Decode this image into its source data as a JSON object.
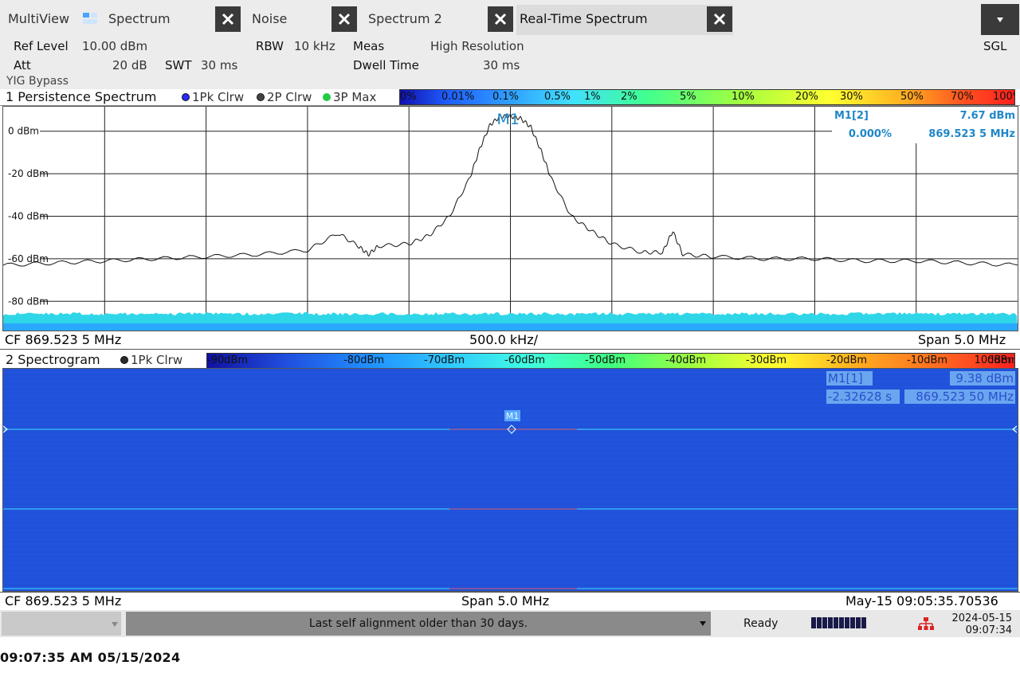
{
  "tabs": {
    "multiview": "MultiView",
    "items": [
      {
        "label": "Spectrum"
      },
      {
        "label": "Noise"
      },
      {
        "label": "Spectrum 2"
      },
      {
        "label": "Real-Time Spectrum"
      }
    ]
  },
  "settings": {
    "ref_level_label": "Ref Level",
    "ref_level_value": "10.00 dBm",
    "att_label": "Att",
    "att_value": "20 dB",
    "swt_label": "SWT",
    "swt_value": "30 ms",
    "rbw_label": "RBW",
    "rbw_value": "10 kHz",
    "meas_label": "Meas",
    "meas_value": "High Resolution",
    "dwell_label": "Dwell Time",
    "dwell_value": "30 ms",
    "yig": "YIG Bypass",
    "sgl": "SGL"
  },
  "panel1": {
    "title": "1 Persistence Spectrum",
    "traces": [
      "1Pk Clrw",
      "2P Clrw",
      "3P Max"
    ],
    "trace_colors": [
      "#2a2aff",
      "#444444",
      "#22cc44"
    ],
    "colorbar_labels": [
      "0%",
      "0.01%",
      "0.1%",
      "0.5%",
      "1%",
      "2%",
      "5%",
      "10%",
      "20%",
      "30%",
      "50%",
      "70%",
      "100%"
    ],
    "marker_label": "M1",
    "marker_info": {
      "name": "M1[2]",
      "level": "7.67 dBm",
      "percent": "0.000%",
      "freq": "869.523 5 MHz"
    },
    "cf": "CF 869.523 5 MHz",
    "div": "500.0 kHz/",
    "span": "Span 5.0 MHz"
  },
  "chart_data": {
    "type": "line",
    "title": "1 Persistence Spectrum",
    "xlabel": "",
    "ylabel": "",
    "x_center_mhz": 869.5235,
    "x_span_mhz": 5.0,
    "ylim": [
      -90,
      10
    ],
    "y_ticks": [
      "0 dBm",
      "-20 dBm",
      "-40 dBm",
      "-60 dBm",
      "-80 dBm"
    ],
    "y_tick_values": [
      0,
      -20,
      -40,
      -60,
      -80
    ],
    "grid": true,
    "series": [
      {
        "x": [
          -2.5,
          -2.25,
          -2.0,
          -1.75,
          -1.5,
          -1.25,
          -1.0,
          -0.85,
          -0.75,
          -0.7,
          -0.65,
          -0.5,
          -0.4,
          -0.3,
          -0.2,
          -0.15,
          -0.1,
          -0.05,
          0.0,
          0.05,
          0.1,
          0.15,
          0.2,
          0.3,
          0.4,
          0.5,
          0.65,
          0.75,
          0.8,
          0.85,
          1.0,
          1.25,
          1.5,
          1.75,
          2.0,
          2.25,
          2.5
        ],
        "y": [
          -63,
          -62,
          -61,
          -60,
          -59,
          -58,
          -56,
          -48,
          -54,
          -58,
          -54,
          -53,
          -49,
          -40,
          -22,
          -8,
          3,
          7,
          7,
          6,
          2,
          -9,
          -22,
          -40,
          -47,
          -53,
          -57,
          -57,
          -47,
          -58,
          -59,
          -60,
          -60,
          -61,
          -61,
          -62,
          -63
        ]
      }
    ]
  },
  "panel2": {
    "title": "2 Spectrogram",
    "trace": "1Pk Clrw",
    "colorbar_labels": [
      "-90dBm",
      "-80dBm",
      "-70dBm",
      "-60dBm",
      "-50dBm",
      "-40dBm",
      "-30dBm",
      "-20dBm",
      "-10dBm",
      "0dBm",
      "10dBm"
    ],
    "marker_label": "M1",
    "marker_info": {
      "name": "M1[1]",
      "level": "9.38 dBm",
      "time": "-2.32628 s",
      "freq": "869.523 50 MHz"
    },
    "cf": "CF 869.523 5 MHz",
    "span": "Span 5.0 MHz",
    "timestamp": "May-15 09:05:35.70536"
  },
  "status": {
    "message": "Last self alignment older than 30 days.",
    "ready": "Ready",
    "date": "2024-05-15",
    "time": "09:07:34"
  },
  "footer_timestamp": "09:07:35 AM  05/15/2024"
}
